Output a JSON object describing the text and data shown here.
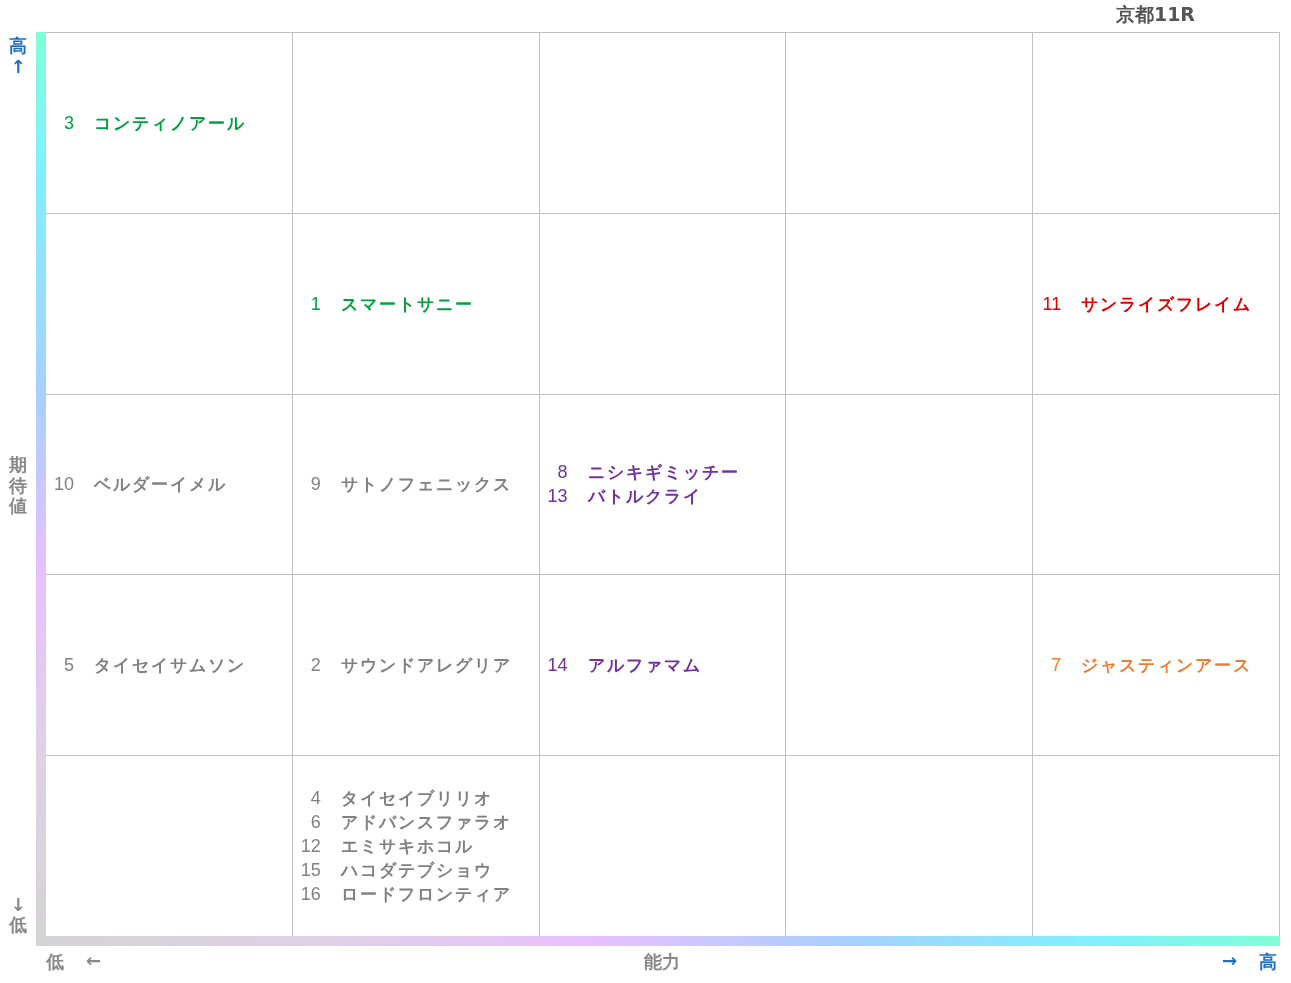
{
  "title": "京都11R",
  "y_axis": {
    "high": "高",
    "high_arrow": "↑",
    "label": "期待値",
    "low_arrow": "↓",
    "low": "低"
  },
  "x_axis": {
    "low": "低",
    "low_arrow": "←",
    "label": "能力",
    "high_arrow": "→",
    "high": "高"
  },
  "rows": [
    {
      "cells": [
        {
          "entries": [
            {
              "number": "3",
              "name": "コンティノアール",
              "color": "#00a040"
            }
          ]
        },
        {},
        {},
        {},
        {}
      ]
    },
    {
      "cells": [
        {},
        {
          "entries": [
            {
              "number": "1",
              "name": "スマートサニー",
              "color": "#00a040"
            }
          ]
        },
        {},
        {},
        {
          "entries": [
            {
              "number": "11",
              "name": "サンライズフレイム",
              "color": "#e00000"
            }
          ]
        }
      ]
    },
    {
      "cells": [
        {
          "entries": [
            {
              "number": "10",
              "name": "ベルダーイメル",
              "color": "#808080"
            }
          ]
        },
        {
          "entries": [
            {
              "number": "9",
              "name": "サトノフェニックス",
              "color": "#808080"
            }
          ]
        },
        {
          "entries": [
            {
              "number": "8",
              "name": "ニシキギミッチー",
              "color": "#7030a0"
            },
            {
              "number": "13",
              "name": "バトルクライ",
              "color": "#7030a0"
            }
          ]
        },
        {},
        {}
      ]
    },
    {
      "cells": [
        {
          "entries": [
            {
              "number": "5",
              "name": "タイセイサムソン",
              "color": "#808080"
            }
          ]
        },
        {
          "entries": [
            {
              "number": "2",
              "name": "サウンドアレグリア",
              "color": "#808080"
            }
          ]
        },
        {
          "entries": [
            {
              "number": "14",
              "name": "アルファマム",
              "color": "#7030a0"
            }
          ]
        },
        {},
        {
          "entries": [
            {
              "number": "7",
              "name": "ジャスティンアース",
              "color": "#ed7d31"
            }
          ]
        }
      ]
    },
    {
      "cells": [
        {},
        {
          "entries": [
            {
              "number": "4",
              "name": "タイセイブリリオ",
              "color": "#808080"
            },
            {
              "number": "6",
              "name": "アドバンスファラオ",
              "color": "#808080"
            },
            {
              "number": "12",
              "name": "エミサキホコル",
              "color": "#808080"
            },
            {
              "number": "15",
              "name": "ハコダテブショウ",
              "color": "#808080"
            },
            {
              "number": "16",
              "name": "ロードフロンティア",
              "color": "#808080"
            }
          ]
        },
        {},
        {},
        {}
      ]
    }
  ]
}
